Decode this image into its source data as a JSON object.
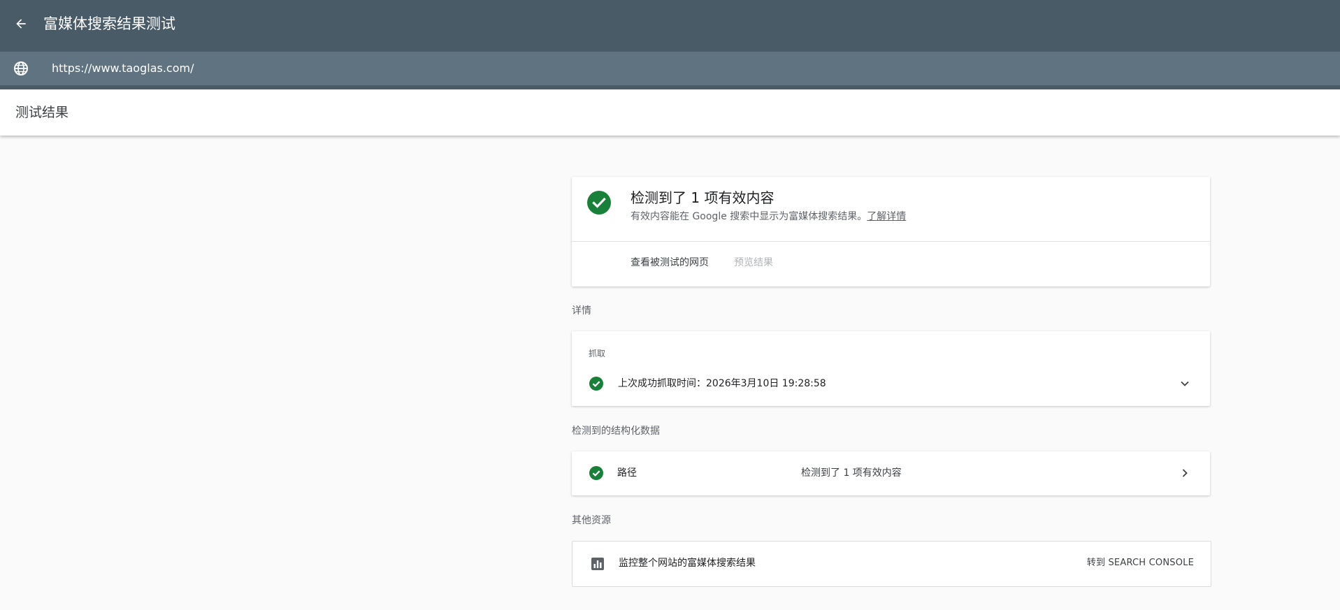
{
  "header": {
    "title": "富媒体搜索结果测试",
    "url": "https://www.taoglas.com/"
  },
  "subheader": {
    "title": "测试结果"
  },
  "summary": {
    "title": "检测到了 1 项有效内容",
    "description": "有效内容能在 Google 搜索中显示为富媒体搜索结果。",
    "learn_more": "了解详情",
    "view_tested_page": "查看被测试的网页",
    "preview_results": "预览结果"
  },
  "details": {
    "section_label": "详情",
    "crawl": {
      "label": "抓取",
      "status_text": "上次成功抓取时间：2026年3月10日 19:28:58"
    }
  },
  "structured_data": {
    "section_label": "检测到的结构化数据",
    "items": [
      {
        "name": "路径",
        "status": "检测到了 1 项有效内容"
      }
    ]
  },
  "resources": {
    "section_label": "其他资源",
    "items": [
      {
        "text": "监控整个网站的富媒体搜索结果",
        "link": "转到 SEARCH CONSOLE"
      }
    ]
  },
  "colors": {
    "header_bg": "#4a5b68",
    "url_bar_bg": "#5f7480",
    "success_green": "#188038",
    "page_bg": "#fafafa"
  },
  "icons": {
    "back": "arrow-back-icon",
    "globe": "globe-icon",
    "success": "check-circle-icon",
    "expand": "chevron-down-icon",
    "open": "chevron-right-icon",
    "chart": "bar-chart-icon"
  }
}
